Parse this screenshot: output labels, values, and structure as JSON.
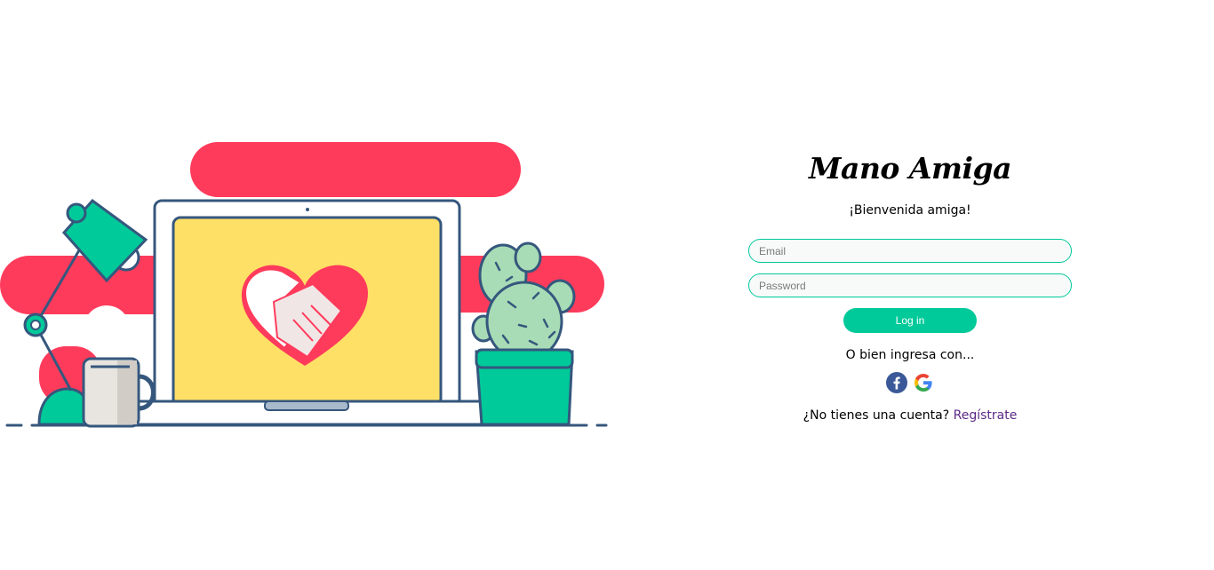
{
  "brand": {
    "title": "Mano Amiga"
  },
  "welcome": "¡Bienvenida amiga!",
  "form": {
    "email_placeholder": "Email",
    "password_placeholder": "Password",
    "login_label": "Log in"
  },
  "alt_login": {
    "text": "O bien ingresa con...",
    "providers": [
      {
        "name": "facebook",
        "icon": "facebook-icon"
      },
      {
        "name": "google",
        "icon": "google-icon"
      }
    ]
  },
  "signup": {
    "prompt": "¿No tienes una cuenta?",
    "link_label": "Regístrate"
  },
  "colors": {
    "accent": "#00c99a",
    "red": "#ff3b5c",
    "yellow": "#ffe066",
    "navy": "#35577d",
    "link": "#5b2a86"
  }
}
